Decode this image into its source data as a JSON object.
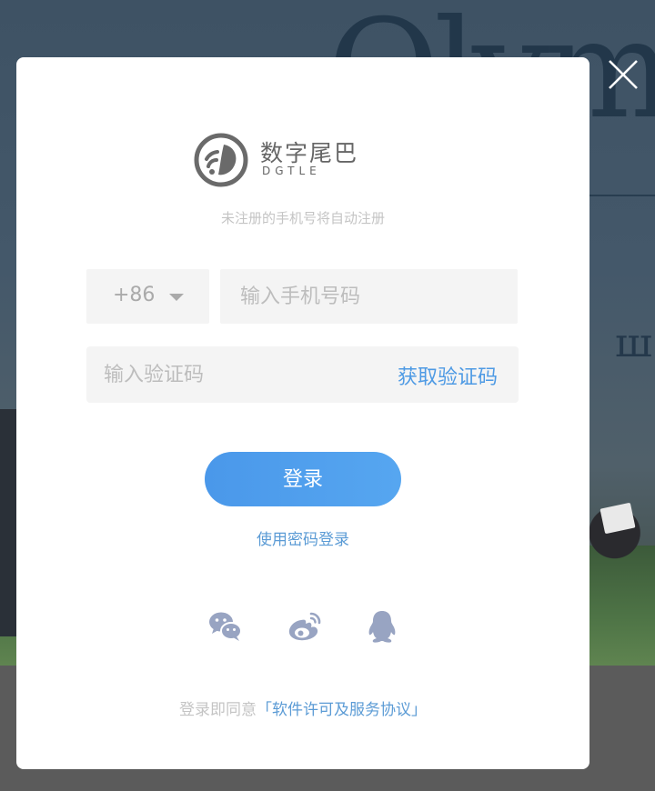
{
  "brand": {
    "name_cn": "数字尾巴",
    "name_en": "DGTLE"
  },
  "tagline": "未注册的手机号将自动注册",
  "form": {
    "country_code": "+86",
    "phone_placeholder": "输入手机号码",
    "code_placeholder": "输入验证码",
    "get_code_label": "获取验证码",
    "login_label": "登录",
    "password_login_label": "使用密码登录"
  },
  "social": [
    {
      "icon": "wechat-icon"
    },
    {
      "icon": "weibo-icon"
    },
    {
      "icon": "qq-icon"
    }
  ],
  "agreement": {
    "prefix": "登录即同意",
    "link": "「软件许可及服务协议」"
  },
  "colors": {
    "accent": "#4e9ae4",
    "button": "#4a98ea",
    "social_icon": "#98a4c2",
    "muted_text": "#c4c4c4"
  }
}
